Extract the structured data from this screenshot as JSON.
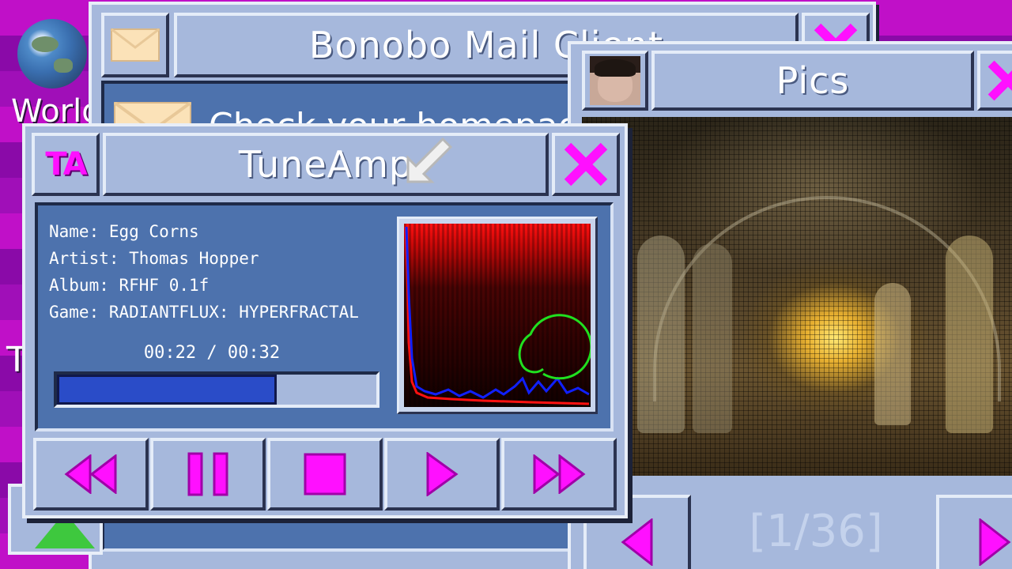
{
  "desktop": {
    "icon_label": "World",
    "partial_label": "T"
  },
  "mail_window": {
    "title": "Bonobo Mail Client",
    "preview_text": "Check your homepage"
  },
  "tuneamp": {
    "logo": "TA",
    "title": "TuneAmp",
    "track": {
      "name_line": "Name: Egg Corns",
      "artist_line": "Artist: Thomas Hopper",
      "album_line": "Album: RFHF 0.1f",
      "game_line": "Game: RADIANTFLUX: HYPERFRACTAL"
    },
    "time_display": "00:22 / 00:32",
    "progress_fraction": 0.6875,
    "controls": {
      "rewind_icon": "rewind-icon",
      "pause_icon": "pause-icon",
      "stop_icon": "stop-icon",
      "play_icon": "play-icon",
      "forward_icon": "fast-forward-icon"
    }
  },
  "pics_window": {
    "title": "Pics",
    "counter": "[1/36]"
  },
  "colors": {
    "accent": "#ff10ff",
    "window": "#a6b8dc",
    "panel": "#4d72ad",
    "progress": "#2a4cc8"
  }
}
